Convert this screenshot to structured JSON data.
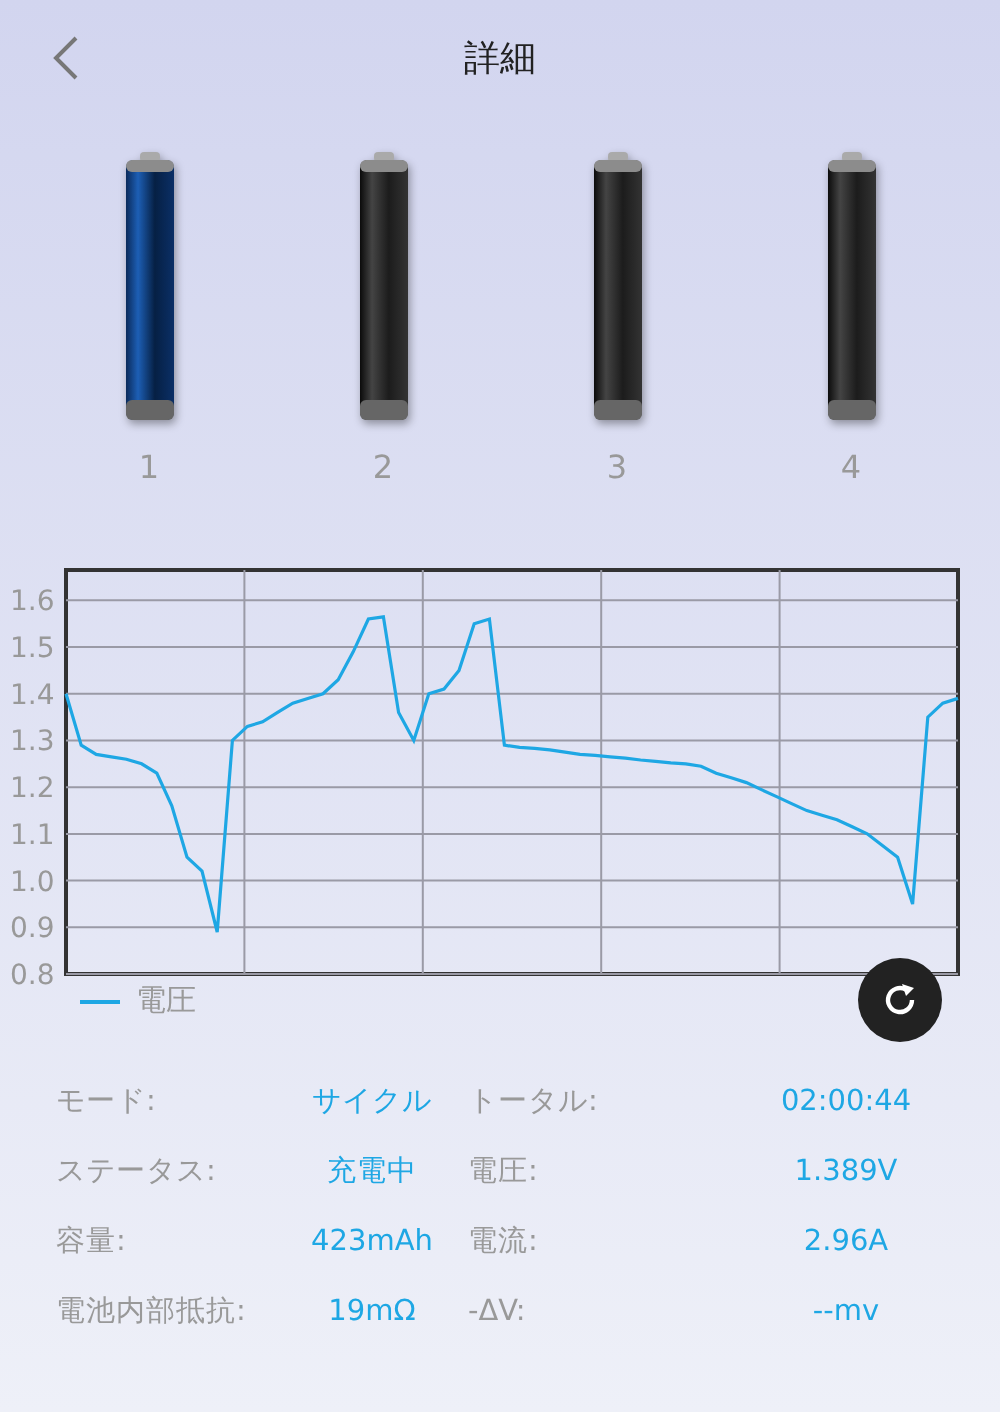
{
  "header": {
    "title": "詳細"
  },
  "batteries": [
    {
      "label": "1",
      "selected": true
    },
    {
      "label": "2",
      "selected": false
    },
    {
      "label": "3",
      "selected": false
    },
    {
      "label": "4",
      "selected": false
    }
  ],
  "chart": {
    "chart_data": {
      "type": "line",
      "grid": true,
      "ylim": [
        0.8,
        1.665
      ],
      "yticks": [
        0.8,
        0.9,
        {
          "value": 1,
          "label": "1.0"
        },
        1.1,
        1.2,
        1.3,
        1.4,
        1.5,
        1.6
      ],
      "series": [
        {
          "name": "電圧",
          "color": "#1ea7e4",
          "values": [
            1.4,
            1.29,
            1.27,
            1.265,
            1.26,
            1.25,
            1.23,
            1.16,
            1.05,
            1.02,
            0.89,
            1.3,
            1.33,
            1.34,
            1.36,
            1.38,
            1.39,
            1.4,
            1.43,
            1.49,
            1.56,
            1.565,
            1.36,
            1.3,
            1.4,
            1.41,
            1.45,
            1.55,
            1.56,
            1.29,
            1.285,
            1.283,
            1.28,
            1.275,
            1.27,
            1.268,
            1.265,
            1.262,
            1.258,
            1.255,
            1.252,
            1.25,
            1.245,
            1.23,
            1.22,
            1.21,
            1.195,
            1.18,
            1.165,
            1.15,
            1.14,
            1.13,
            1.115,
            1.1,
            1.075,
            1.05,
            0.95,
            1.35,
            1.38,
            1.39
          ]
        }
      ]
    }
  },
  "stats": [
    {
      "label": "モード:",
      "value": "サイクル"
    },
    {
      "label": "トータル:",
      "value": "02:00:44"
    },
    {
      "label": "ステータス:",
      "value": "充電中"
    },
    {
      "label": "電圧:",
      "value": "1.389V"
    },
    {
      "label": "容量:",
      "value": "423mAh"
    },
    {
      "label": "電流:",
      "value": "2.96A"
    },
    {
      "label": "電池内部抵抗:",
      "value": "19mΩ"
    },
    {
      "label": "-ΔV:",
      "value": "--mv"
    }
  ]
}
